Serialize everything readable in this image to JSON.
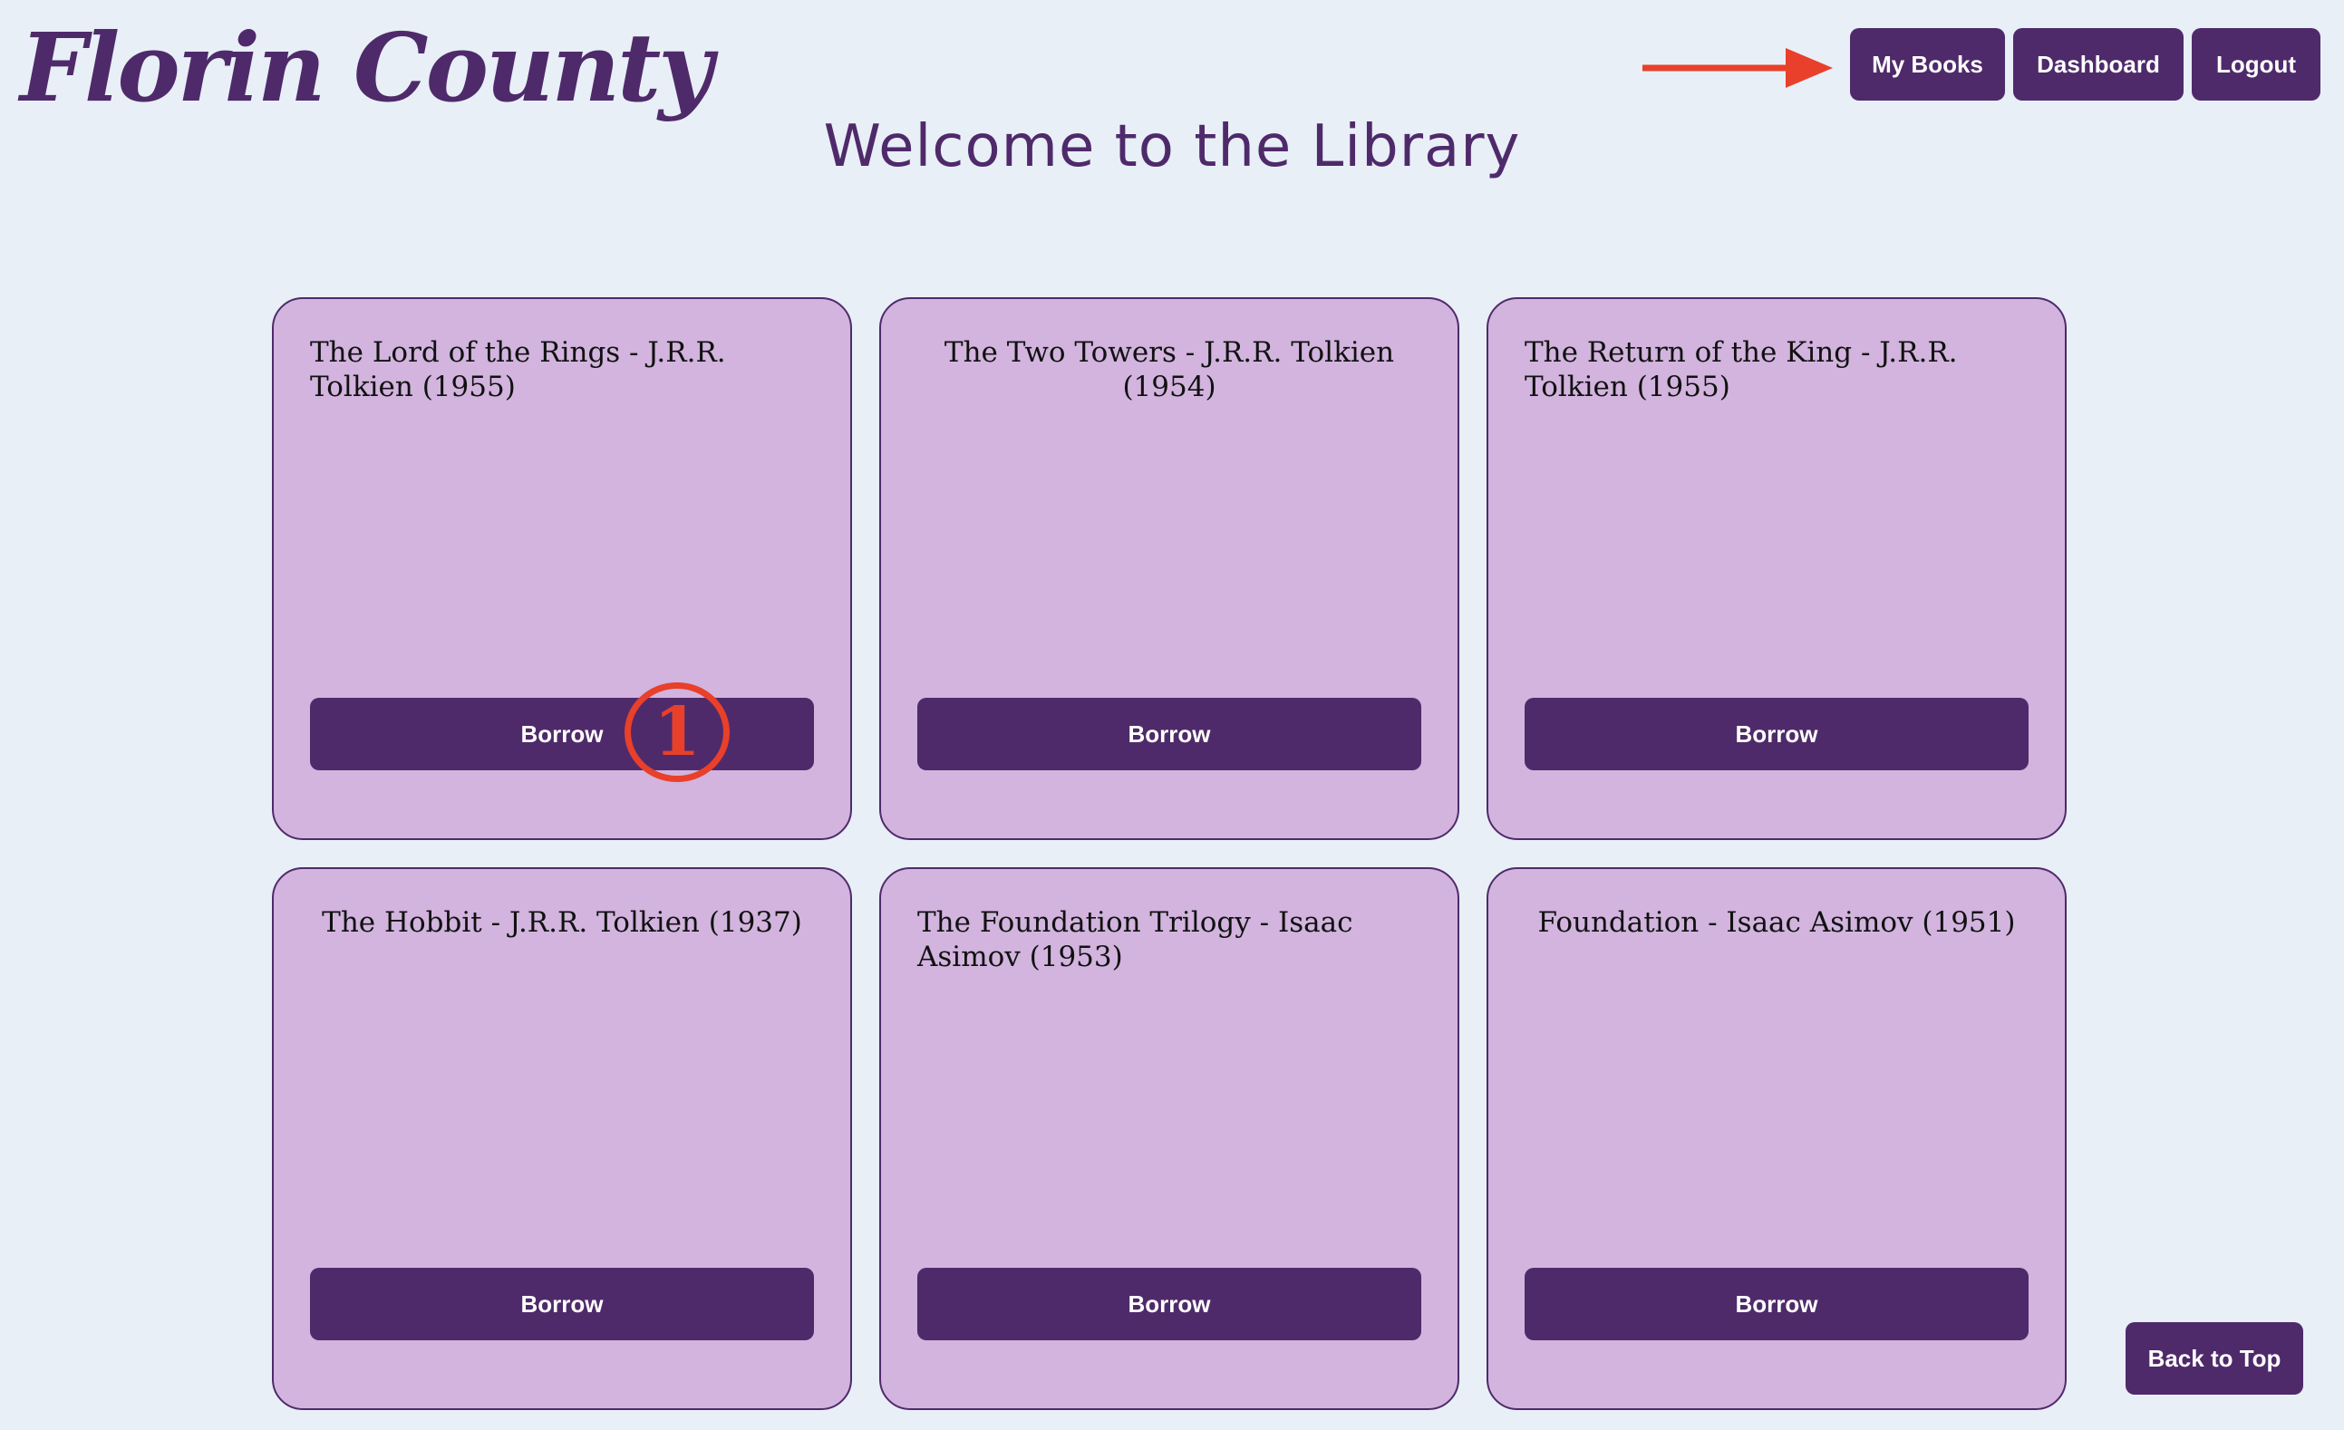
{
  "header": {
    "brand": "Florin County",
    "nav": {
      "my_books": "My Books",
      "dashboard": "Dashboard",
      "logout": "Logout"
    }
  },
  "main": {
    "title": "Welcome to the Library",
    "books": [
      {
        "title": "The Lord of the Rings - J.R.R. Tolkien (1955)",
        "action": "Borrow"
      },
      {
        "title": "The Two Towers - J.R.R. Tolkien (1954)",
        "action": "Borrow"
      },
      {
        "title": "The Return of the King - J.R.R. Tolkien (1955)",
        "action": "Borrow"
      },
      {
        "title": "The Hobbit - J.R.R. Tolkien (1937)",
        "action": "Borrow"
      },
      {
        "title": "The Foundation Trilogy - Isaac Asimov (1953)",
        "action": "Borrow"
      },
      {
        "title": "Foundation - Isaac Asimov (1951)",
        "action": "Borrow"
      }
    ]
  },
  "footer": {
    "back_to_top": "Back to Top"
  },
  "annotations": {
    "step_marker": "1",
    "arrow_icon": "right-arrow-icon",
    "color": "#e8402a"
  },
  "colors": {
    "background": "#e8eff7",
    "primary": "#4f2a6a",
    "card": "#d2b4de"
  }
}
